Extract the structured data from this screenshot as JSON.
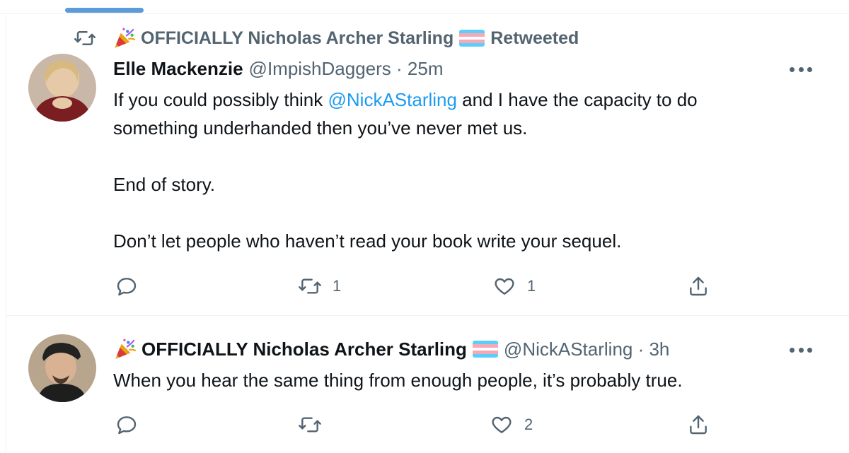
{
  "retweet_header": {
    "retweeter_name": "OFFICIALLY Nicholas Archer Starling",
    "label": "Retweeted"
  },
  "tweets": [
    {
      "author_name": "Elle Mackenzie",
      "handle_time": "@ImpishDaggers · 25m",
      "text_before_mention": "If you could possibly think ",
      "mention": "@NickAStarling",
      "text_after_mention": " and I have the capacity to do\nsomething underhanded then you’ve never met us.\n\nEnd of story.\n\nDon’t let people who haven’t read your book write your sequel.",
      "retweets": "1",
      "likes": "1"
    },
    {
      "author_name": "OFFICIALLY Nicholas Archer Starling",
      "handle_time": "@NickAStarling · 3h",
      "text": "When you hear the same thing from enough people, it’s probably true.",
      "retweets": "",
      "likes": "2"
    }
  ],
  "icons": {
    "retweet": "retweet-icon",
    "reply": "reply-icon",
    "like": "heart-icon",
    "share": "share-icon",
    "more": "more-icon",
    "party": "party-popper-icon",
    "flag": "transgender-flag-icon"
  },
  "colors": {
    "link": "#1d9bf0",
    "secondary_text": "#536471",
    "tab_indicator": "#5b9bd9",
    "flag_blue": "#5bcefa",
    "flag_pink": "#f5a9b8",
    "flag_white": "#ffffff"
  }
}
